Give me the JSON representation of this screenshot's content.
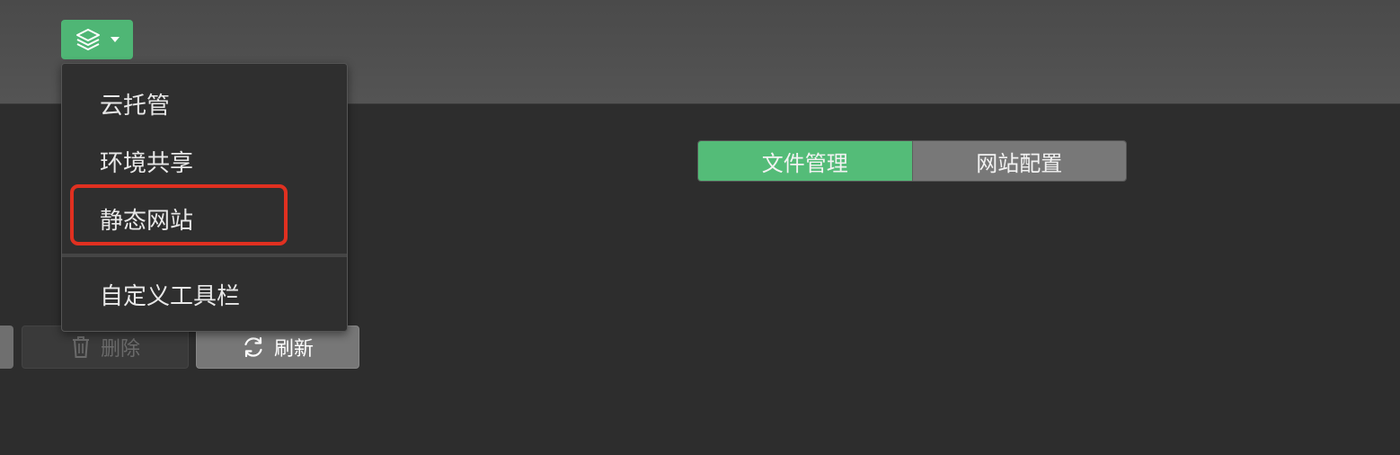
{
  "header": {
    "layers_button_icon": "layers-icon",
    "caret_icon": "caret-down-icon"
  },
  "dropdown": {
    "items": [
      {
        "label": "云托管"
      },
      {
        "label": "环境共享"
      },
      {
        "label": "静态网站"
      },
      {
        "label": "自定义工具栏"
      }
    ]
  },
  "tabs": [
    {
      "label": "文件管理",
      "active": true
    },
    {
      "label": "网站配置",
      "active": false
    }
  ],
  "toolbar": {
    "delete_label": "删除",
    "delete_icon": "trash-icon",
    "refresh_label": "刷新",
    "refresh_icon": "refresh-icon"
  },
  "colors": {
    "accent_green": "#54bc78",
    "highlight_red": "#e03020",
    "background": "#2d2d2d"
  }
}
